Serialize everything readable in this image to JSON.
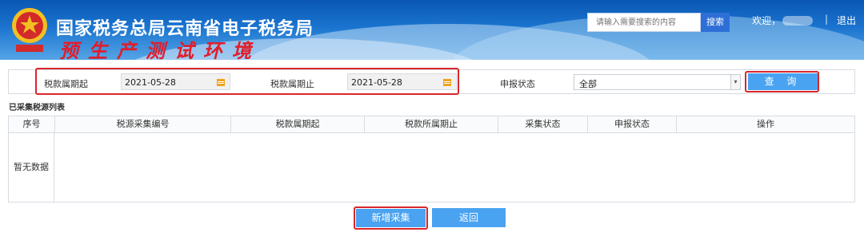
{
  "header": {
    "title": "国家税务总局云南省电子税务局",
    "subtitle": "预生产测试环境",
    "search_placeholder": "请输入需要搜索的内容",
    "search_button": "搜索",
    "welcome": "欢迎，",
    "separator": "|",
    "logout": "退出"
  },
  "query": {
    "start_label": "税款属期起",
    "start_value": "2021-05-28",
    "end_label": "税款属期止",
    "end_value": "2021-05-28",
    "status_label": "申报状态",
    "status_value": "全部",
    "query_button": "查 询"
  },
  "list": {
    "title": "已采集税源列表",
    "columns": [
      "序号",
      "税源采集编号",
      "税款属期起",
      "税款所属期止",
      "采集状态",
      "申报状态",
      "操作"
    ],
    "empty_text": "暂无数据"
  },
  "actions": {
    "add_button": "新增采集",
    "back_button": "返回"
  },
  "colors": {
    "accent_button": "#4aa3f0",
    "highlight_border": "#d9262b",
    "header_blue": "#1a74cf"
  }
}
